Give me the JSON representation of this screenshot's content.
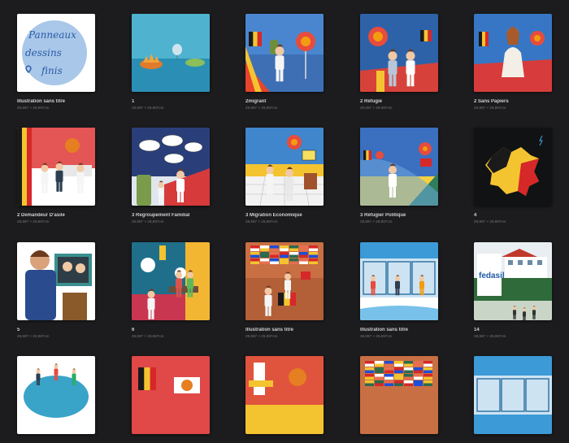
{
  "gallery": {
    "items": [
      {
        "title": "Illustration sans titre",
        "dims": "29,997 × 29,997cm",
        "art": "handwritten",
        "art_text": [
          "Panneaux",
          "dessins",
          "finis"
        ]
      },
      {
        "title": "1",
        "dims": "29,997 × 29,997cm",
        "art": "sea-balloon"
      },
      {
        "title": "2migrant",
        "dims": "29,997 × 29,997cm",
        "art": "migrant"
      },
      {
        "title": "2 Réfugié",
        "dims": "29,997 × 29,997cm",
        "art": "refugee"
      },
      {
        "title": "2 Sans Papiers",
        "dims": "29,997 × 29,997cm",
        "art": "sans-papiers"
      },
      {
        "title": "2 Demandeur D'asile",
        "dims": "29,997 × 29,997cm",
        "art": "asylum"
      },
      {
        "title": "3 Regroupement Familial",
        "dims": "29,997 × 29,997cm",
        "art": "family"
      },
      {
        "title": "3 Migration Économique",
        "dims": "29,997 × 29,997cm",
        "art": "economic"
      },
      {
        "title": "3 Réfugier Politique",
        "dims": "29,997 × 29,997cm",
        "art": "political"
      },
      {
        "title": "4",
        "dims": "29,997 × 29,997cm",
        "art": "belgium-map"
      },
      {
        "title": "5",
        "dims": "29,997 × 29,997cm",
        "art": "office"
      },
      {
        "title": "6",
        "dims": "29,997 × 29,997cm",
        "art": "bench"
      },
      {
        "title": "Illustration sans titre",
        "dims": "29,997 × 29,997cm",
        "art": "flags-wall"
      },
      {
        "title": "Illustration sans titre",
        "dims": "29,997 × 29,997cm",
        "art": "blue-room"
      },
      {
        "title": "14",
        "dims": "29,997 × 29,997cm",
        "art": "fedasil",
        "art_text": [
          "fedasil"
        ]
      },
      {
        "title": "",
        "dims": "",
        "art": "round-table"
      },
      {
        "title": "",
        "dims": "",
        "art": "red-flags"
      },
      {
        "title": "",
        "dims": "",
        "art": "yellow-red"
      },
      {
        "title": "",
        "dims": "",
        "art": "flags-wall-2"
      },
      {
        "title": "",
        "dims": "",
        "art": "blue-room-2"
      }
    ]
  },
  "colors": {
    "background": "#1c1c1e",
    "title_text": "#cfcfd3",
    "dims_text": "#77777c",
    "belgian_black": "#1a1a1a",
    "belgian_yellow": "#f4c430",
    "belgian_red": "#d62828"
  }
}
